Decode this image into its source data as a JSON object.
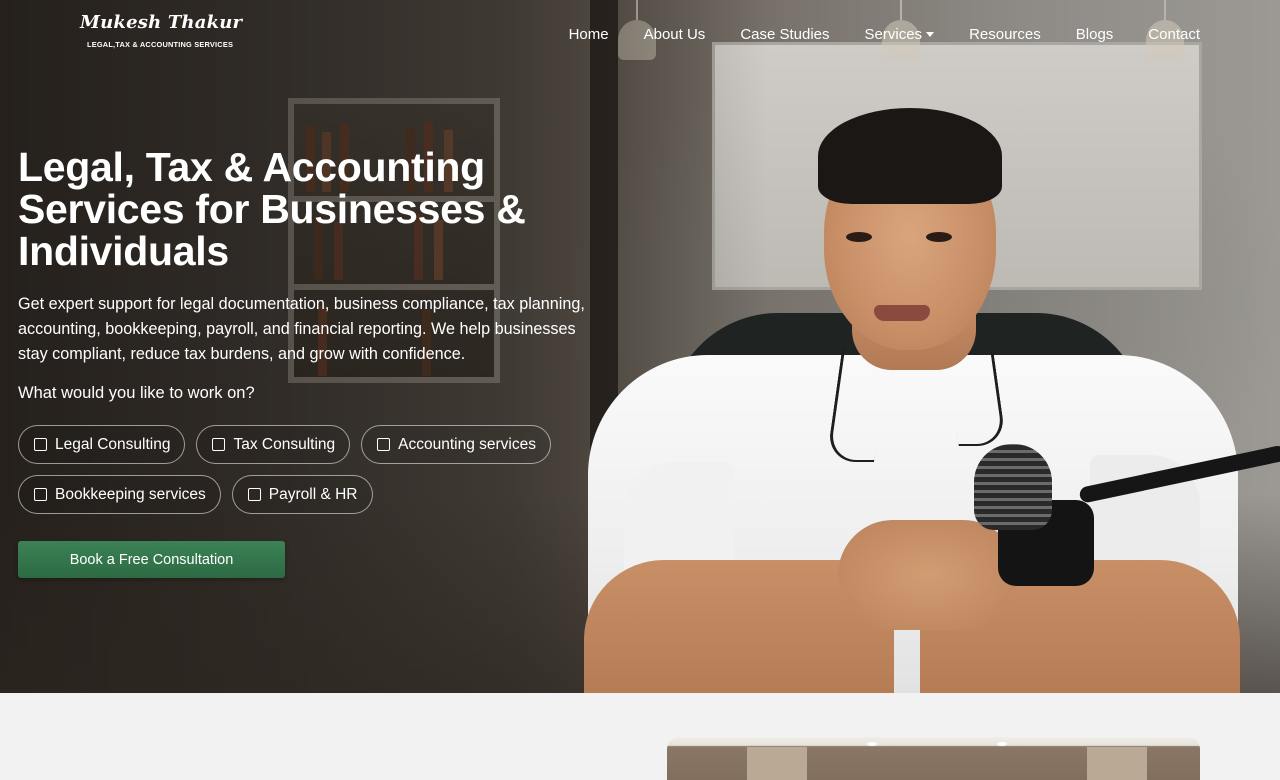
{
  "brand": {
    "name": "Mukesh Thakur",
    "tagline": "LEGAL,TAX & ACCOUNTING SERVICES"
  },
  "nav": {
    "items": [
      "Home",
      "About Us",
      "Case Studies",
      "Services",
      "Resources",
      "Blogs",
      "Contact"
    ]
  },
  "hero": {
    "headline": "Legal, Tax & Accounting Services for Businesses & Individuals",
    "description": "Get expert support for legal documentation, business compliance, tax planning, accounting, bookkeeping, payroll, and financial reporting. We help businesses stay compliant, reduce tax burdens, and grow with confidence.",
    "question": "What would you like to work on?",
    "options": [
      "Legal Consulting",
      "Tax Consulting",
      "Accounting services",
      "Bookkeeping services",
      "Payroll & HR"
    ],
    "cta_label": "Book a Free Consultation"
  },
  "colors": {
    "cta": "#2f6e46",
    "text_on_hero": "#ffffff",
    "page_bg": "#f2f2f2"
  }
}
